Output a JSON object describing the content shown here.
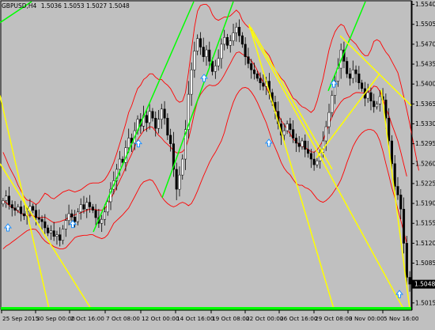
{
  "header": {
    "symbol": "GBPUSD,H4",
    "ohlc": "1.5036 1.5053 1.5027 1.5048"
  },
  "colors": {
    "background": "#c0c0c0",
    "candle": "#000000",
    "bull_body": "#ffffff",
    "bear_body": "#000000",
    "bollinger": "#ff0000",
    "trend_green": "#00ff00",
    "trend_yellow": "#ffff00",
    "arrow": "#1e90ff",
    "price_box": "#000000"
  },
  "chart_data": {
    "type": "candlestick",
    "y_ticks": [
      "1.5540",
      "1.5505",
      "1.5470",
      "1.5435",
      "1.5400",
      "1.5365",
      "1.5330",
      "1.5295",
      "1.5260",
      "1.5225",
      "1.5190",
      "1.5155",
      "1.5120",
      "1.5085",
      "1.5048",
      "1.5015"
    ],
    "ylim": [
      1.5005,
      1.5545
    ],
    "x_ticks": [
      "25 Sep 2015",
      "30 Sep 00:00",
      "2 Oct 16:00",
      "7 Oct 08:00",
      "12 Oct 00:00",
      "14 Oct 16:00",
      "19 Oct 08:00",
      "22 Oct 00:00",
      "26 Oct 16:00",
      "29 Oct 08:00",
      "3 Nov 00:00",
      "5 Nov 16:00"
    ],
    "current_price": "1.5048",
    "closes": [
      1.5195,
      1.5203,
      1.5188,
      1.5182,
      1.5178,
      1.5184,
      1.5172,
      1.5168,
      1.5176,
      1.5185,
      1.5178,
      1.5165,
      1.5162,
      1.5158,
      1.5147,
      1.5138,
      1.5142,
      1.5132,
      1.5135,
      1.5125,
      1.5145,
      1.516,
      1.5172,
      1.5166,
      1.5158,
      1.5175,
      1.5188,
      1.518,
      1.5192,
      1.5184,
      1.5178,
      1.5165,
      1.5155,
      1.5162,
      1.5175,
      1.5193,
      1.5215,
      1.523,
      1.525,
      1.5268,
      1.5262,
      1.5288,
      1.5305,
      1.5296,
      1.5318,
      1.5338,
      1.5326,
      1.5345,
      1.5332,
      1.5352,
      1.534,
      1.5322,
      1.5338,
      1.5356,
      1.534,
      1.531,
      1.5295,
      1.525,
      1.5215,
      1.524,
      1.5268,
      1.532,
      1.5382,
      1.5425,
      1.5458,
      1.548,
      1.5465,
      1.5448,
      1.546,
      1.544,
      1.5422,
      1.5432,
      1.5445,
      1.547,
      1.5482,
      1.5468,
      1.5476,
      1.549,
      1.55,
      1.5485,
      1.547,
      1.5448,
      1.5436,
      1.5425,
      1.5418,
      1.541,
      1.5402,
      1.5396,
      1.5405,
      1.5385,
      1.5368,
      1.5352,
      1.533,
      1.531,
      1.5318,
      1.533,
      1.532,
      1.5305,
      1.5296,
      1.529,
      1.53,
      1.5285,
      1.5278,
      1.5268,
      1.5258,
      1.5265,
      1.528,
      1.53,
      1.5325,
      1.535,
      1.538,
      1.5405,
      1.5428,
      1.546,
      1.544,
      1.5418,
      1.541,
      1.5425,
      1.5418,
      1.5402,
      1.5392,
      1.5375,
      1.5385,
      1.537,
      1.536,
      1.5365,
      1.5378,
      1.5372,
      1.534,
      1.53,
      1.526,
      1.522,
      1.5205,
      1.518,
      1.512,
      1.506,
      1.5048
    ],
    "bb_upper": [
      1.528,
      1.5268,
      1.5255,
      1.5245,
      1.5235,
      1.5222,
      1.5212,
      1.5202,
      1.5196,
      1.5195,
      1.5192,
      1.5188,
      1.5192,
      1.52,
      1.5208,
      1.5205,
      1.52,
      1.5198,
      1.5202,
      1.5206,
      1.521,
      1.5212,
      1.5214,
      1.5212,
      1.521,
      1.5212,
      1.5214,
      1.5218,
      1.5222,
      1.5225,
      1.5226,
      1.5226,
      1.5226,
      1.5228,
      1.5232,
      1.524,
      1.525,
      1.5262,
      1.5278,
      1.5295,
      1.5312,
      1.533,
      1.535,
      1.5362,
      1.5378,
      1.5392,
      1.5398,
      1.5408,
      1.5412,
      1.5418,
      1.5418,
      1.5412,
      1.5408,
      1.5408,
      1.5402,
      1.5398,
      1.5392,
      1.5382,
      1.5372,
      1.5368,
      1.537,
      1.5385,
      1.542,
      1.546,
      1.55,
      1.5528,
      1.5538,
      1.554,
      1.554,
      1.5535,
      1.5522,
      1.5515,
      1.5512,
      1.5515,
      1.5518,
      1.5518,
      1.552,
      1.5525,
      1.553,
      1.5525,
      1.5512,
      1.5505,
      1.55,
      1.5496,
      1.549,
      1.548,
      1.547,
      1.5462,
      1.5456,
      1.545,
      1.5438,
      1.5425,
      1.5418,
      1.541,
      1.5405,
      1.5395,
      1.5385,
      1.5375,
      1.5372,
      1.5365,
      1.536,
      1.5358,
      1.5354,
      1.535,
      1.5355,
      1.537,
      1.539,
      1.541,
      1.5435,
      1.546,
      1.5478,
      1.5492,
      1.55,
      1.5505,
      1.5502,
      1.549,
      1.548,
      1.5475,
      1.547,
      1.5462,
      1.5455,
      1.545,
      1.545,
      1.546,
      1.5475,
      1.5478,
      1.5475,
      1.5465,
      1.5456,
      1.545,
      1.544,
      1.543,
      1.542,
      1.54,
      1.5378,
      1.5355,
      1.533,
      1.5302,
      1.5275,
      1.5248
    ],
    "bb_lower": [
      1.511,
      1.5115,
      1.5118,
      1.5122,
      1.5126,
      1.513,
      1.5134,
      1.5138,
      1.5142,
      1.5144,
      1.5145,
      1.5144,
      1.5138,
      1.513,
      1.5124,
      1.512,
      1.5118,
      1.5114,
      1.5112,
      1.511,
      1.511,
      1.5112,
      1.5118,
      1.5124,
      1.513,
      1.5132,
      1.5133,
      1.5134,
      1.5134,
      1.5135,
      1.5135,
      1.5132,
      1.513,
      1.5128,
      1.513,
      1.5135,
      1.5145,
      1.5155,
      1.516,
      1.5165,
      1.517,
      1.5176,
      1.5182,
      1.5192,
      1.5202,
      1.5212,
      1.5222,
      1.5228,
      1.523,
      1.5232,
      1.523,
      1.5222,
      1.5212,
      1.5202,
      1.5195,
      1.519,
      1.5186,
      1.5184,
      1.5186,
      1.519,
      1.5192,
      1.519,
      1.5186,
      1.519,
      1.52,
      1.5212,
      1.5225,
      1.5238,
      1.525,
      1.5262,
      1.5272,
      1.528,
      1.529,
      1.53,
      1.5315,
      1.5335,
      1.5352,
      1.5368,
      1.538,
      1.5388,
      1.5393,
      1.5394,
      1.5392,
      1.5386,
      1.5378,
      1.5368,
      1.5356,
      1.5344,
      1.5332,
      1.5316,
      1.53,
      1.5288,
      1.5276,
      1.5262,
      1.5252,
      1.5245,
      1.524,
      1.5232,
      1.5225,
      1.5222,
      1.5222,
      1.5218,
      1.5216,
      1.5212,
      1.5205,
      1.5198,
      1.5194,
      1.5192,
      1.5195,
      1.52,
      1.5206,
      1.5214,
      1.5222,
      1.5232,
      1.5246,
      1.5262,
      1.5276,
      1.529,
      1.53,
      1.5308,
      1.5314,
      1.5318,
      1.532,
      1.532,
      1.5318,
      1.5312,
      1.53,
      1.5282,
      1.526,
      1.524,
      1.5218,
      1.52,
      1.518,
      1.516,
      1.514,
      1.512
    ],
    "trendlines_green": [
      [
        [
          0,
          1.5508
        ],
        [
          40,
          1.5545
        ]
      ],
      [
        [
          118,
          1.514
        ],
        [
          245,
          1.5545
        ]
      ],
      [
        [
          205,
          1.52
        ],
        [
          295,
          1.5545
        ]
      ],
      [
        [
          415,
          1.5388
        ],
        [
          462,
          1.5545
        ]
      ]
    ],
    "trendlines_yellow": [
      [
        [
          0,
          1.538
        ],
        [
          62,
          1.5005
        ]
      ],
      [
        [
          0,
          1.526
        ],
        [
          115,
          1.5005
        ]
      ],
      [
        [
          315,
          1.5505
        ],
        [
          422,
          1.5005
        ]
      ],
      [
        [
          315,
          1.55
        ],
        [
          510,
          1.5005
        ]
      ],
      [
        [
          317,
          1.55
        ],
        [
          420,
          1.525
        ]
      ],
      [
        [
          430,
          1.5485
        ],
        [
          520,
          1.5362
        ]
      ],
      [
        [
          400,
          1.527
        ],
        [
          480,
          1.5418
        ]
      ],
      [
        [
          482,
          1.539
        ],
        [
          518,
          1.5005
        ]
      ]
    ],
    "up_arrows": [
      [
        10,
        1.5147
      ],
      [
        92,
        1.5153
      ],
      [
        175,
        1.5295
      ],
      [
        258,
        1.541
      ],
      [
        340,
        1.5296
      ],
      [
        422,
        1.54
      ],
      [
        505,
        1.503
      ]
    ]
  }
}
